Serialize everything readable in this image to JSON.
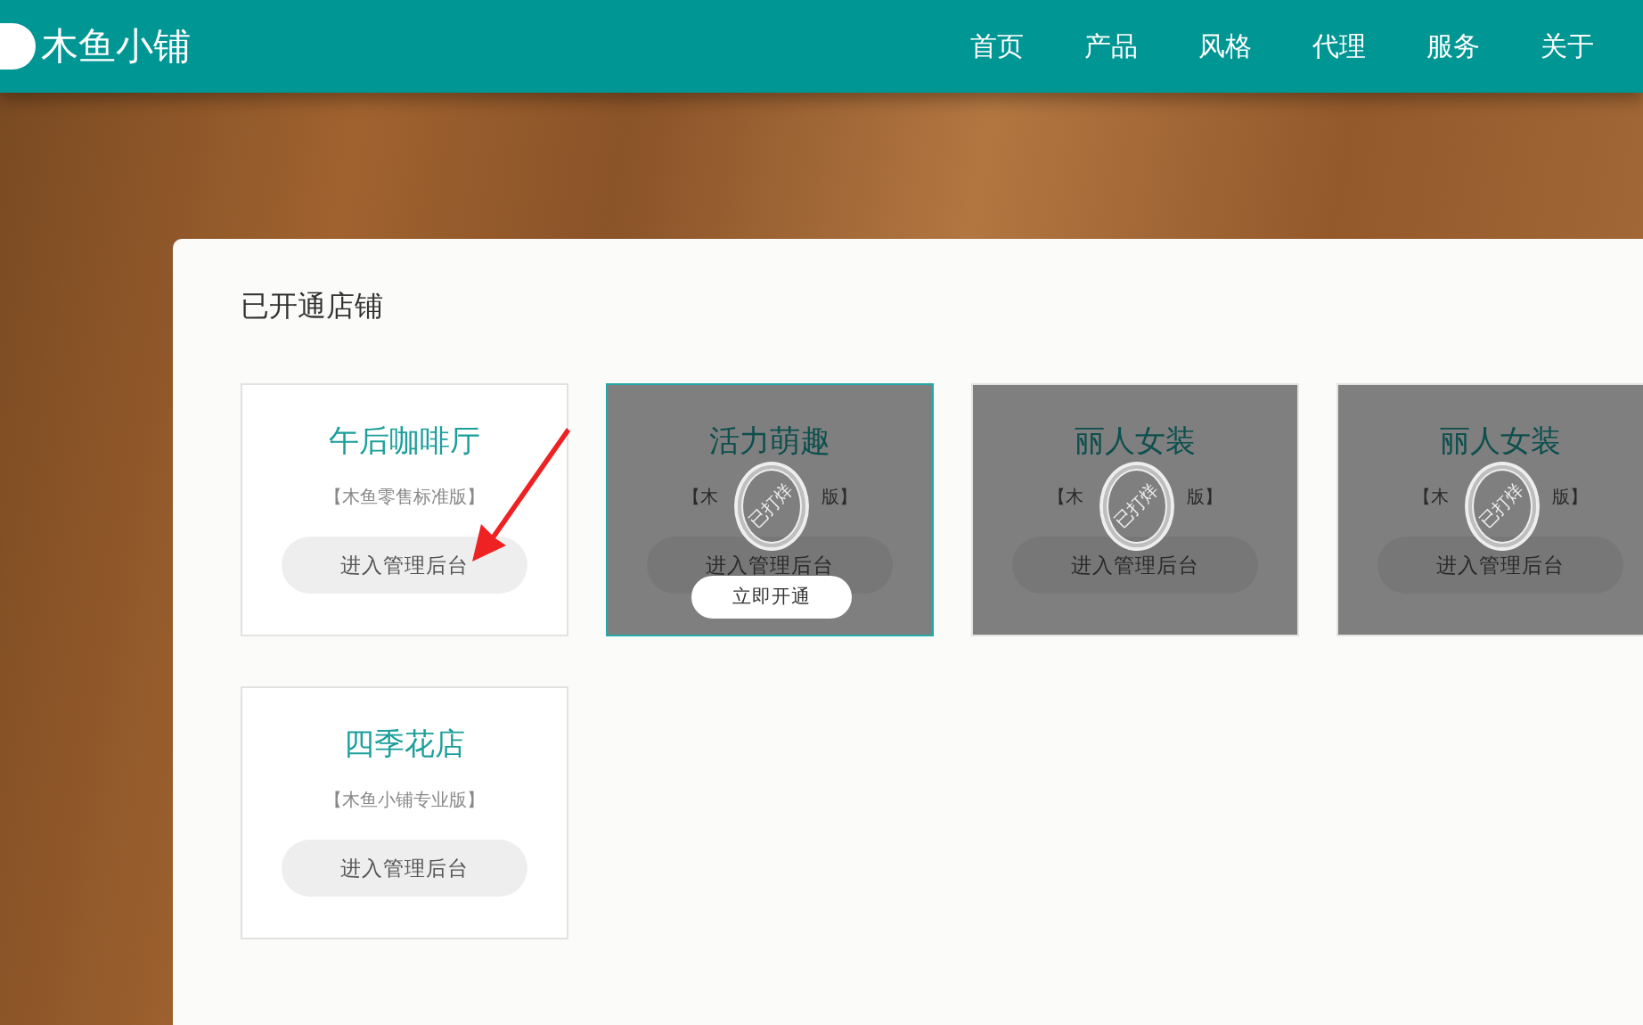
{
  "header": {
    "brand": "木鱼小铺",
    "nav": [
      {
        "label": "首页"
      },
      {
        "label": "产品"
      },
      {
        "label": "风格"
      },
      {
        "label": "代理"
      },
      {
        "label": "服务"
      },
      {
        "label": "关于"
      }
    ]
  },
  "panel": {
    "title": "已开通店铺",
    "shops": [
      {
        "name": "午后咖啡厅",
        "edition": "【木鱼零售标准版】",
        "button": "进入管理后台",
        "closed": false,
        "selected": false
      },
      {
        "name": "活力萌趣",
        "edition_parts": [
          "【木",
          "版】"
        ],
        "button": "进入管理后台",
        "closed": true,
        "stamp": "已打烊",
        "selected": true,
        "open_button": "立即开通"
      },
      {
        "name": "丽人女装",
        "edition_parts": [
          "【木",
          "版】"
        ],
        "button": "进入管理后台",
        "closed": true,
        "stamp": "已打烊",
        "selected": false
      },
      {
        "name": "丽人女装",
        "edition_parts": [
          "【木",
          "版】"
        ],
        "button": "进入管理后台",
        "closed": true,
        "stamp": "已打烊",
        "selected": false
      },
      {
        "name": "四季花店",
        "edition": "【木鱼小铺专业版】",
        "button": "进入管理后台",
        "closed": false,
        "selected": false
      }
    ]
  }
}
